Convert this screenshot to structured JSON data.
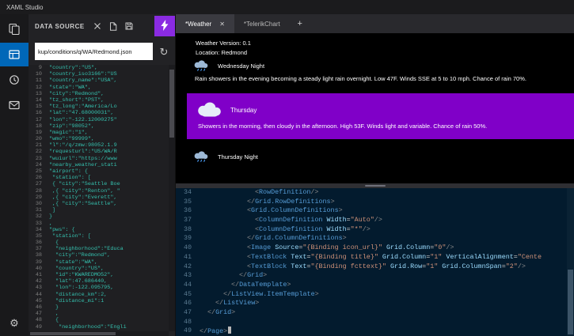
{
  "app": {
    "title": "XAML Studio"
  },
  "colors": {
    "activity_active": "#0067B8",
    "bolt_button": "#8A2BE2",
    "selection_purple": "#8000C8",
    "editor_bg": "#031B2E",
    "json_text": "#35C0AE",
    "tag_blue": "#569CD6",
    "attr_blue": "#9CDCFE",
    "string_orange": "#CE9178"
  },
  "activity_bar": {
    "items": [
      {
        "icon": "documents",
        "active": false
      },
      {
        "icon": "data-source",
        "active": true
      },
      {
        "icon": "debugger",
        "active": false
      },
      {
        "icon": "feedback",
        "active": false
      }
    ],
    "settings_glyph": "⚙"
  },
  "data_source_panel": {
    "title": "DATA SOURCE",
    "header_icons": [
      {
        "icon": "close"
      },
      {
        "icon": "new-file"
      },
      {
        "icon": "save"
      }
    ],
    "bolt_icon": "bolt",
    "url_value": "kup/conditions/q/WA/Redmond.json",
    "refresh_glyph": "↻",
    "json_lines": [
      {
        "n": 9,
        "ind": 1,
        "text": "\"country\":\"US\","
      },
      {
        "n": 10,
        "ind": 1,
        "text": "\"country_iso3166\":\"US"
      },
      {
        "n": 11,
        "ind": 1,
        "text": "\"country_name\":\"USA\","
      },
      {
        "n": 12,
        "ind": 1,
        "text": "\"state\":\"WA\","
      },
      {
        "n": 13,
        "ind": 1,
        "text": "\"city\":\"Redmond\","
      },
      {
        "n": 14,
        "ind": 1,
        "text": "\"tz_short\":\"PST\","
      },
      {
        "n": 15,
        "ind": 1,
        "text": "\"tz_long\":\"America/Lo"
      },
      {
        "n": 16,
        "ind": 1,
        "text": "\"lat\":\"47.68000031\","
      },
      {
        "n": 17,
        "ind": 1,
        "text": "\"lon\":\"-122.12000275\""
      },
      {
        "n": 18,
        "ind": 1,
        "text": "\"zip\":\"98052\","
      },
      {
        "n": 19,
        "ind": 1,
        "text": "\"magic\":\"1\","
      },
      {
        "n": 20,
        "ind": 1,
        "text": "\"wmo\":\"99999\","
      },
      {
        "n": 21,
        "ind": 1,
        "text": "\"l\":\"/q/zmw:98052.1.9"
      },
      {
        "n": 22,
        "ind": 1,
        "text": "\"requesturl\":\"US/WA/R"
      },
      {
        "n": 23,
        "ind": 1,
        "text": "\"wuiurl\":\"https://www"
      },
      {
        "n": 24,
        "ind": 1,
        "text": "\"nearby_weather_stati"
      },
      {
        "n": 25,
        "ind": 1,
        "text": "\"airport\": {"
      },
      {
        "n": 26,
        "ind": 2,
        "text": "\"station\": ["
      },
      {
        "n": 27,
        "ind": 2,
        "text": "{ \"city\":\"Seattle Boe"
      },
      {
        "n": 28,
        "ind": 2,
        "text": ",{ \"city\":\"Renton\", \""
      },
      {
        "n": 29,
        "ind": 2,
        "text": ",{ \"city\":\"Everett\","
      },
      {
        "n": 30,
        "ind": 2,
        "text": ",{ \"city\":\"Seattle\","
      },
      {
        "n": 31,
        "ind": 2,
        "text": "]"
      },
      {
        "n": 32,
        "ind": 1,
        "text": "}"
      },
      {
        "n": 33,
        "ind": 1,
        "text": ","
      },
      {
        "n": 34,
        "ind": 1,
        "text": "\"pws\": {"
      },
      {
        "n": 35,
        "ind": 2,
        "text": "\"station\": ["
      },
      {
        "n": 36,
        "ind": 3,
        "text": "{"
      },
      {
        "n": 37,
        "ind": 3,
        "text": "\"neighborhood\":\"Educa"
      },
      {
        "n": 38,
        "ind": 3,
        "text": "\"city\":\"Redmond\","
      },
      {
        "n": 39,
        "ind": 3,
        "text": "\"state\":\"WA\","
      },
      {
        "n": 40,
        "ind": 3,
        "text": "\"country\":\"US\","
      },
      {
        "n": 41,
        "ind": 3,
        "text": "\"id\":\"KWAREDMO52\","
      },
      {
        "n": 42,
        "ind": 3,
        "text": "\"lat\":47.686440,"
      },
      {
        "n": 43,
        "ind": 3,
        "text": "\"lon\":-122.095795,"
      },
      {
        "n": 44,
        "ind": 3,
        "text": "\"distance_km\":2,"
      },
      {
        "n": 45,
        "ind": 3,
        "text": "\"distance_mi\":1"
      },
      {
        "n": 46,
        "ind": 3,
        "text": "}"
      },
      {
        "n": 47,
        "ind": 3,
        "text": ","
      },
      {
        "n": 48,
        "ind": 3,
        "text": "{"
      },
      {
        "n": 49,
        "ind": 4,
        "text": "\"neighborhood\":\"Engli"
      }
    ]
  },
  "tab_bar": {
    "tabs": [
      {
        "label": "*Weather",
        "active": true,
        "close_glyph": "✕"
      },
      {
        "label": "*TelerikChart",
        "active": false
      }
    ],
    "new_tab_glyph": "+"
  },
  "preview": {
    "version_line": "Weather Version: 0.1",
    "location_line": "Location: Redmond",
    "items": [
      {
        "icon": "rain-cloud",
        "title": "Wednesday Night",
        "text": "Rain showers in the evening becoming a steady light rain overnight. Low 47F. Winds SSE at 5 to 10 mph. Chance of rain 70%.",
        "selected": false
      },
      {
        "icon": "cloud",
        "title": "Thursday",
        "text": "Showers in the morning, then cloudy in the afternoon. High 53F. Winds light and variable. Chance of rain 50%.",
        "selected": true
      },
      {
        "icon": "rain-cloud",
        "title": "Thursday Night",
        "text": "",
        "selected": false
      }
    ]
  },
  "editor": {
    "lines": [
      {
        "n": 34,
        "ind": 14,
        "tokens": [
          [
            "d",
            "<"
          ],
          [
            "t",
            "RowDefinition"
          ],
          [
            "d",
            "/>"
          ]
        ]
      },
      {
        "n": 35,
        "ind": 12,
        "tokens": [
          [
            "d",
            "</"
          ],
          [
            "t",
            "Grid.RowDefinitions"
          ],
          [
            "d",
            ">"
          ]
        ]
      },
      {
        "n": 36,
        "ind": 12,
        "tokens": [
          [
            "d",
            "<"
          ],
          [
            "t",
            "Grid.ColumnDefinitions"
          ],
          [
            "d",
            ">"
          ]
        ]
      },
      {
        "n": 37,
        "ind": 14,
        "tokens": [
          [
            "d",
            "<"
          ],
          [
            "t",
            "ColumnDefinition"
          ],
          [
            "a",
            " Width"
          ],
          [
            "o",
            "="
          ],
          [
            "s",
            "\"Auto\""
          ],
          [
            "d",
            "/>"
          ]
        ]
      },
      {
        "n": 38,
        "ind": 14,
        "tokens": [
          [
            "d",
            "<"
          ],
          [
            "t",
            "ColumnDefinition"
          ],
          [
            "a",
            " Width"
          ],
          [
            "o",
            "="
          ],
          [
            "s",
            "\"*\""
          ],
          [
            "d",
            "/>"
          ]
        ]
      },
      {
        "n": 39,
        "ind": 12,
        "tokens": [
          [
            "d",
            "</"
          ],
          [
            "t",
            "Grid.ColumnDefinitions"
          ],
          [
            "d",
            ">"
          ]
        ]
      },
      {
        "n": 40,
        "ind": 12,
        "tokens": [
          [
            "d",
            "<"
          ],
          [
            "t",
            "Image"
          ],
          [
            "a",
            " Source"
          ],
          [
            "o",
            "="
          ],
          [
            "s",
            "\"{Binding icon_url}\""
          ],
          [
            "a",
            " Grid.Column"
          ],
          [
            "o",
            "="
          ],
          [
            "s",
            "\"0\""
          ],
          [
            "d",
            "/>"
          ]
        ]
      },
      {
        "n": 41,
        "ind": 12,
        "tokens": [
          [
            "d",
            "<"
          ],
          [
            "t",
            "TextBlock"
          ],
          [
            "a",
            " Text"
          ],
          [
            "o",
            "="
          ],
          [
            "s",
            "\"{Binding title}\""
          ],
          [
            "a",
            " Grid.Column"
          ],
          [
            "o",
            "="
          ],
          [
            "s",
            "\"1\""
          ],
          [
            "a",
            " VerticalAlignment"
          ],
          [
            "o",
            "="
          ],
          [
            "s",
            "\"Cente"
          ]
        ]
      },
      {
        "n": 42,
        "ind": 12,
        "tokens": [
          [
            "d",
            "<"
          ],
          [
            "t",
            "TextBlock"
          ],
          [
            "a",
            " Text"
          ],
          [
            "o",
            "="
          ],
          [
            "s",
            "\"{Binding fcttext}\""
          ],
          [
            "a",
            " Grid.Row"
          ],
          [
            "o",
            "="
          ],
          [
            "s",
            "\"1\""
          ],
          [
            "a",
            " Grid.ColumnSpan"
          ],
          [
            "o",
            "="
          ],
          [
            "s",
            "\"2\""
          ],
          [
            "d",
            "/>"
          ]
        ]
      },
      {
        "n": 43,
        "ind": 10,
        "tokens": [
          [
            "d",
            "</"
          ],
          [
            "t",
            "Grid"
          ],
          [
            "d",
            ">"
          ]
        ]
      },
      {
        "n": 44,
        "ind": 8,
        "tokens": [
          [
            "d",
            "</"
          ],
          [
            "t",
            "DataTemplate"
          ],
          [
            "d",
            ">"
          ]
        ]
      },
      {
        "n": 45,
        "ind": 6,
        "tokens": [
          [
            "d",
            "</"
          ],
          [
            "t",
            "ListView.ItemTemplate"
          ],
          [
            "d",
            ">"
          ]
        ]
      },
      {
        "n": 46,
        "ind": 4,
        "tokens": [
          [
            "d",
            "</"
          ],
          [
            "t",
            "ListView"
          ],
          [
            "d",
            ">"
          ]
        ]
      },
      {
        "n": 47,
        "ind": 2,
        "tokens": [
          [
            "d",
            "</"
          ],
          [
            "t",
            "Grid"
          ],
          [
            "d",
            ">"
          ]
        ]
      },
      {
        "n": 48,
        "ind": 0,
        "tokens": []
      },
      {
        "n": 49,
        "ind": 0,
        "tokens": [
          [
            "d",
            "</"
          ],
          [
            "t",
            "Page"
          ],
          [
            "d",
            ">"
          ]
        ],
        "cursor": true
      }
    ]
  }
}
